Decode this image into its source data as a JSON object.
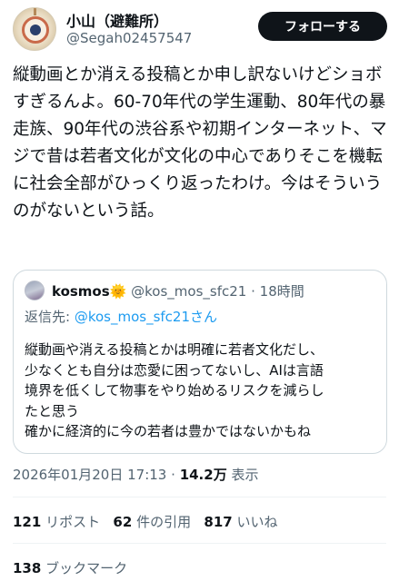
{
  "author": {
    "display_name": "小山（避難所）",
    "handle": "@Segah02457547"
  },
  "follow_button": {
    "label": "フォローする"
  },
  "tweet": {
    "text": "縦動画とか消える投稿とか申し訳ないけどショボすぎるんよ。60-70年代の学生運動、80年代の暴走族、90年代の渋谷系や初期インターネット、マジで昔は若者文化が文化の中心でありそこを機転に社会全部がひっくり返ったわけ。今はそういうのがないという話。"
  },
  "quoted": {
    "display_name": "kosmos",
    "emoji": "🌞",
    "handle": "@kos_mos_sfc21",
    "time": "18時間",
    "reply_prefix": "返信先: ",
    "reply_to": "@kos_mos_sfc21さん",
    "lines": [
      "縦動画や消える投稿とかは明確に若者文化だし、",
      "少なくとも自分は恋愛に困ってないし、AIは言語",
      "境界を低くして物事をやり始めるリスクを減らし",
      "たと思う",
      "確かに経済的に今の若者は豊かではないかもね"
    ]
  },
  "meta": {
    "timestamp": "2026年01月20日 17:13",
    "separator": "·",
    "views_count": "14.2万",
    "views_label": "表示"
  },
  "stats": {
    "reposts_count": "121",
    "reposts_label": "リポスト",
    "quotes_count": "62",
    "quotes_label": "件の引用",
    "likes_count": "817",
    "likes_label": "いいね",
    "bookmarks_count": "138",
    "bookmarks_label": "ブックマーク"
  }
}
